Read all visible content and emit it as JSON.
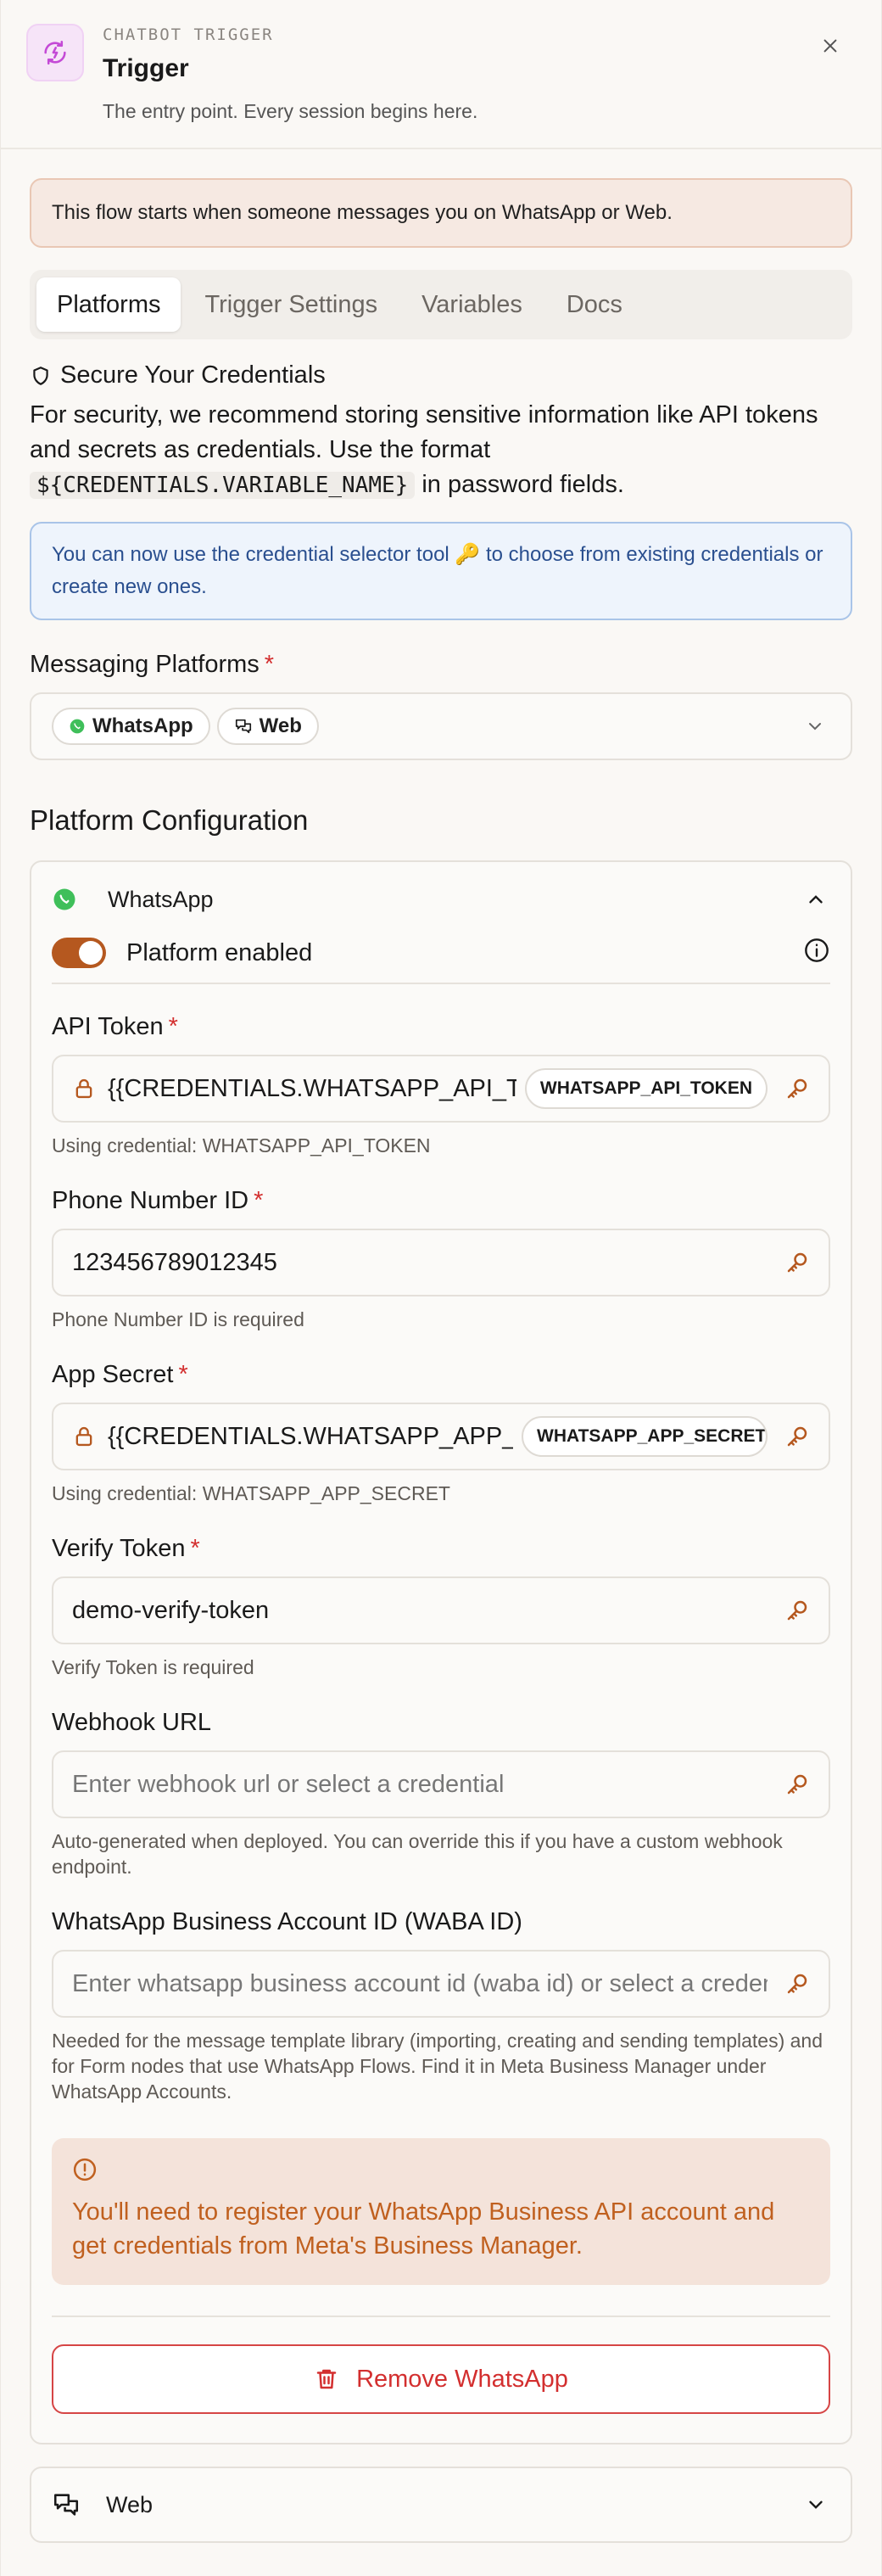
{
  "header": {
    "kicker": "CHATBOT TRIGGER",
    "title": "Trigger",
    "subtitle": "The entry point. Every session begins here."
  },
  "notice": "This flow starts when someone messages you on WhatsApp or Web.",
  "tabs": [
    {
      "label": "Platforms",
      "active": true
    },
    {
      "label": "Trigger Settings",
      "active": false
    },
    {
      "label": "Variables",
      "active": false
    },
    {
      "label": "Docs",
      "active": false
    }
  ],
  "security": {
    "heading": "Secure Your Credentials",
    "text_before": "For security, we recommend storing sensitive information like API tokens and secrets as credentials. Use the format",
    "code": "${CREDENTIALS.VARIABLE_NAME}",
    "text_after": "in password fields.",
    "info": "You can now use the credential selector tool 🔑 to choose from existing credentials or create new ones."
  },
  "messaging": {
    "label": "Messaging Platforms",
    "required": "*",
    "chips": [
      "WhatsApp",
      "Web"
    ]
  },
  "platform_config": {
    "heading": "Platform Configuration",
    "whatsapp": {
      "name": "WhatsApp",
      "toggle_label": "Platform enabled",
      "enabled": true,
      "fields": {
        "api_token": {
          "label": "API Token",
          "required": "*",
          "value": "{{CREDENTIALS.WHATSAPP_API_TOKEN}}",
          "chip": "WHATSAPP_API_TOKEN",
          "help": "Using credential: WHATSAPP_API_TOKEN"
        },
        "phone_number_id": {
          "label": "Phone Number ID",
          "required": "*",
          "value": "123456789012345",
          "help": "Phone Number ID is required"
        },
        "app_secret": {
          "label": "App Secret",
          "required": "*",
          "value": "{{CREDENTIALS.WHATSAPP_APP_SECRET}}",
          "chip": "WHATSAPP_APP_SECRET",
          "help": "Using credential: WHATSAPP_APP_SECRET"
        },
        "verify_token": {
          "label": "Verify Token",
          "required": "*",
          "value": "demo-verify-token",
          "help": "Verify Token is required"
        },
        "webhook_url": {
          "label": "Webhook URL",
          "placeholder": "Enter webhook url or select a credential",
          "help": "Auto-generated when deployed. You can override this if you have a custom webhook endpoint."
        },
        "waba_id": {
          "label": "WhatsApp Business Account ID (WABA ID)",
          "placeholder": "Enter whatsapp business account id (waba id) or select a credential",
          "help": "Needed for the message template library (importing, creating and sending templates) and for Form nodes that use WhatsApp Flows. Find it in Meta Business Manager under WhatsApp Accounts."
        }
      },
      "warning": "You'll need to register your WhatsApp Business API account and get credentials from Meta's Business Manager.",
      "remove_label": "Remove WhatsApp"
    },
    "web": {
      "name": "Web"
    }
  },
  "colors": {
    "accent": "#b5581f",
    "danger": "#d32f2f",
    "info_text": "#2a4f8f",
    "whatsapp_green": "#3fbf5a"
  }
}
